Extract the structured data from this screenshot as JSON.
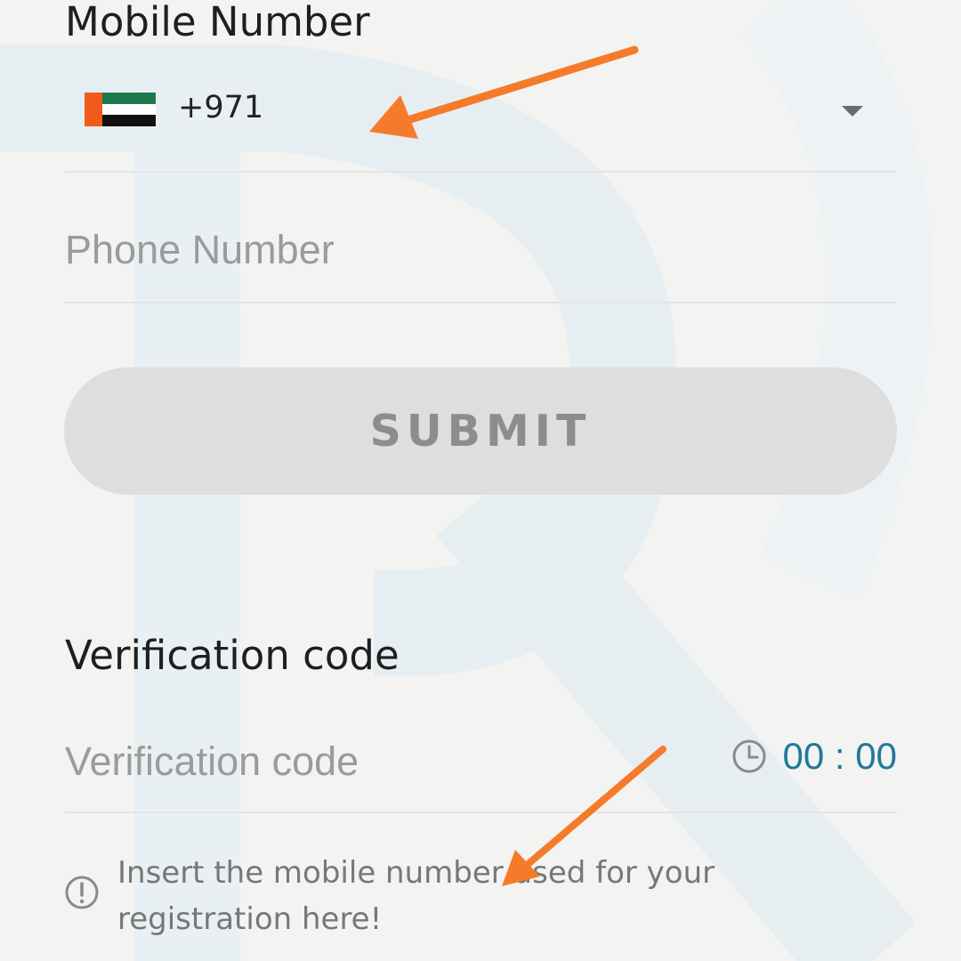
{
  "mobile_number": {
    "title": "Mobile Number",
    "country_code": "+971",
    "flag_icon": "uae-flag-icon"
  },
  "phone_number": {
    "placeholder": "Phone Number"
  },
  "submit": {
    "label": "SUBMIT"
  },
  "verification": {
    "title": "Verification code",
    "placeholder": "Verification code",
    "timer": "00 : 00",
    "timer_icon": "clock-icon"
  },
  "hint": {
    "text": "Insert the mobile number used for your registration here!",
    "icon": "alert-circle-icon"
  },
  "colors": {
    "accent": "#1f7a9c",
    "annotation": "#f57b2a",
    "button_bg": "#dedede"
  }
}
